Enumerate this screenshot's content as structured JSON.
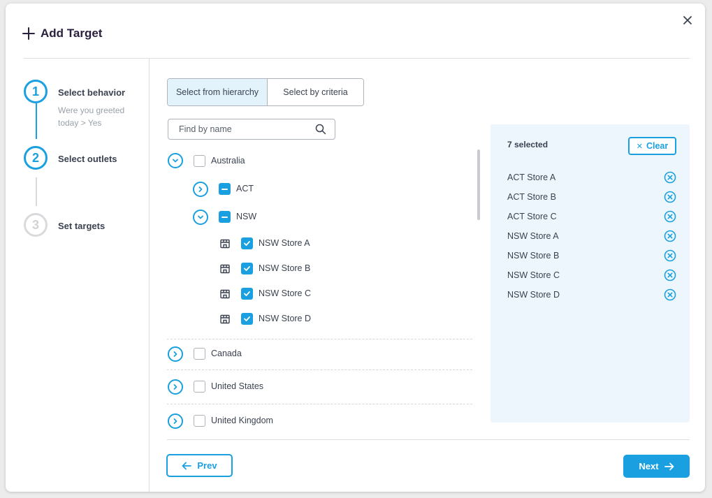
{
  "dialog": {
    "title": "Add Target"
  },
  "steps": [
    {
      "number": "1",
      "title": "Select behavior",
      "subtitle_line1": "Were you greeted",
      "subtitle_line2": "today > Yes",
      "state": "active"
    },
    {
      "number": "2",
      "title": "Select outlets",
      "state": "active"
    },
    {
      "number": "3",
      "title": "Set targets",
      "state": "inactive"
    }
  ],
  "tabs": {
    "hierarchy": "Select from hierarchy",
    "criteria": "Select by criteria",
    "selected": "hierarchy"
  },
  "search": {
    "placeholder": "Find by name",
    "value": ""
  },
  "tree": {
    "australia": {
      "label": "Australia",
      "expanded": true,
      "checked": "unchecked"
    },
    "act": {
      "label": "ACT",
      "expanded": false,
      "checked": "partial"
    },
    "nsw": {
      "label": "NSW",
      "expanded": true,
      "checked": "partial"
    },
    "stores": [
      {
        "label": "NSW Store A",
        "checked": "checked",
        "icon": "store-icon"
      },
      {
        "label": "NSW Store B",
        "checked": "checked",
        "icon": "store-icon"
      },
      {
        "label": "NSW Store C",
        "checked": "checked",
        "icon": "store-icon"
      },
      {
        "label": "NSW Store D",
        "checked": "checked",
        "icon": "store-icon"
      }
    ],
    "canada": {
      "label": "Canada",
      "expanded": false,
      "checked": "unchecked"
    },
    "united_states": {
      "label": "United States",
      "expanded": false,
      "checked": "unchecked"
    },
    "united_kingdom": {
      "label": "United Kingdom",
      "expanded": false,
      "checked": "unchecked"
    }
  },
  "selection": {
    "count_label": "7 selected",
    "clear_label": "Clear",
    "items": [
      "ACT Store A",
      "ACT Store B",
      "ACT Store C",
      "NSW Store A",
      "NSW Store B",
      "NSW Store C",
      "NSW Store D"
    ]
  },
  "footer": {
    "prev_label": "Prev",
    "next_label": "Next"
  },
  "colors": {
    "accent": "#1aa0e0",
    "panel_bg": "#edf6fc",
    "title": "#2a1f3d"
  }
}
